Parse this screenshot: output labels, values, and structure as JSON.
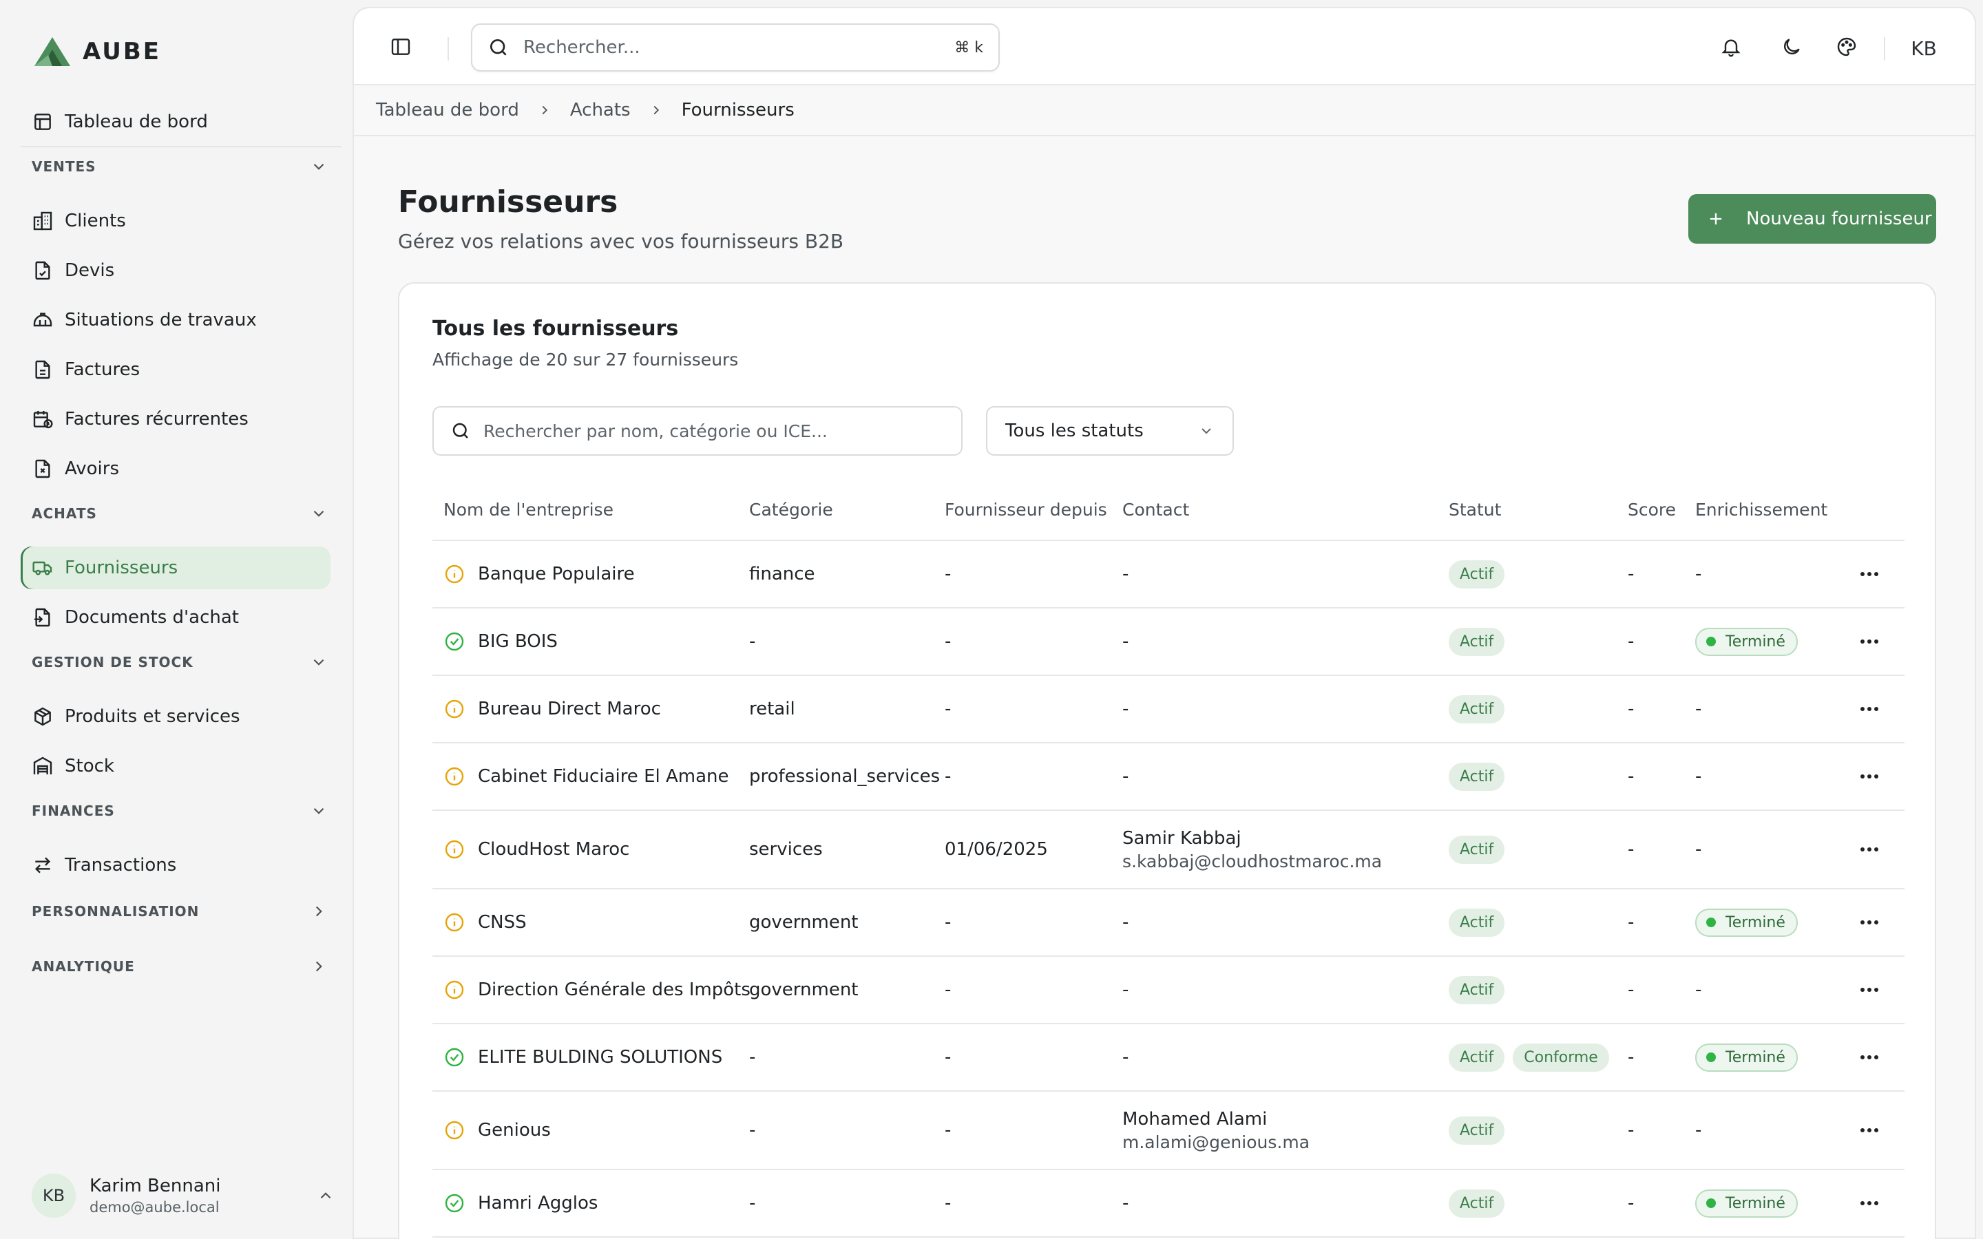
{
  "app": {
    "name": "AUBE"
  },
  "sidebar": {
    "dashboard": "Tableau de bord",
    "sections": {
      "ventes": "VENTES",
      "achats": "ACHATS",
      "stock": "GESTION DE STOCK",
      "finances": "FINANCES",
      "perso": "PERSONNALISATION",
      "analytique": "ANALYTIQUE"
    },
    "items": {
      "clients": "Clients",
      "devis": "Devis",
      "situations": "Situations de travaux",
      "factures": "Factures",
      "factures_recurrentes": "Factures récurrentes",
      "avoirs": "Avoirs",
      "fournisseurs": "Fournisseurs",
      "documents_achat": "Documents d'achat",
      "produits": "Produits et services",
      "stock": "Stock",
      "transactions": "Transactions"
    },
    "user": {
      "initials": "KB",
      "name": "Karim Bennani",
      "email": "demo@aube.local"
    }
  },
  "topbar": {
    "search_placeholder": "Rechercher...",
    "shortcut": "⌘ k",
    "avatar": "KB"
  },
  "breadcrumb": [
    "Tableau de bord",
    "Achats",
    "Fournisseurs"
  ],
  "page": {
    "title": "Fournisseurs",
    "subtitle": "Gérez vos relations avec vos fournisseurs B2B",
    "new_button": "Nouveau fournisseur"
  },
  "card": {
    "title": "Tous les fournisseurs",
    "subtitle": "Affichage de 20 sur 27 fournisseurs",
    "filter_placeholder": "Rechercher par nom, catégorie ou ICE...",
    "status_select": "Tous les statuts"
  },
  "table": {
    "headers": [
      "Nom de l'entreprise",
      "Catégorie",
      "Fournisseur depuis",
      "Contact",
      "Statut",
      "Score",
      "Enrichissement"
    ],
    "rows": [
      {
        "icon": "info",
        "name": "Banque Populaire",
        "category": "finance",
        "since": "-",
        "contact": "-",
        "email": "",
        "statuses": [
          "Actif"
        ],
        "score": "-",
        "enrich": "-"
      },
      {
        "icon": "check",
        "name": "BIG BOIS",
        "category": "-",
        "since": "-",
        "contact": "-",
        "email": "",
        "statuses": [
          "Actif"
        ],
        "score": "-",
        "enrich": "Terminé"
      },
      {
        "icon": "info",
        "name": "Bureau Direct Maroc",
        "category": "retail",
        "since": "-",
        "contact": "-",
        "email": "",
        "statuses": [
          "Actif"
        ],
        "score": "-",
        "enrich": "-"
      },
      {
        "icon": "info",
        "name": "Cabinet Fiduciaire El Amane",
        "category": "professional_services",
        "since": "-",
        "contact": "-",
        "email": "",
        "statuses": [
          "Actif"
        ],
        "score": "-",
        "enrich": "-"
      },
      {
        "icon": "info",
        "name": "CloudHost Maroc",
        "category": "services",
        "since": "01/06/2025",
        "contact": "Samir Kabbaj",
        "email": "s.kabbaj@cloudhostmaroc.ma",
        "statuses": [
          "Actif"
        ],
        "score": "-",
        "enrich": "-"
      },
      {
        "icon": "info",
        "name": "CNSS",
        "category": "government",
        "since": "-",
        "contact": "-",
        "email": "",
        "statuses": [
          "Actif"
        ],
        "score": "-",
        "enrich": "Terminé"
      },
      {
        "icon": "info",
        "name": "Direction Générale des Impôts",
        "category": "government",
        "since": "-",
        "contact": "-",
        "email": "",
        "statuses": [
          "Actif"
        ],
        "score": "-",
        "enrich": "-"
      },
      {
        "icon": "check",
        "name": "ELITE BULDING SOLUTIONS",
        "category": "-",
        "since": "-",
        "contact": "-",
        "email": "",
        "statuses": [
          "Actif",
          "Conforme"
        ],
        "score": "-",
        "enrich": "Terminé"
      },
      {
        "icon": "info",
        "name": "Genious",
        "category": "-",
        "since": "-",
        "contact": "Mohamed Alami",
        "email": "m.alami@genious.ma",
        "statuses": [
          "Actif"
        ],
        "score": "-",
        "enrich": "-"
      },
      {
        "icon": "check",
        "name": "Hamri Agglos",
        "category": "-",
        "since": "-",
        "contact": "-",
        "email": "",
        "statuses": [
          "Actif"
        ],
        "score": "-",
        "enrich": "Terminé"
      }
    ]
  },
  "colors": {
    "accent": "#4c8b5a",
    "warning": "#e5a50a",
    "success": "#2fb344"
  }
}
